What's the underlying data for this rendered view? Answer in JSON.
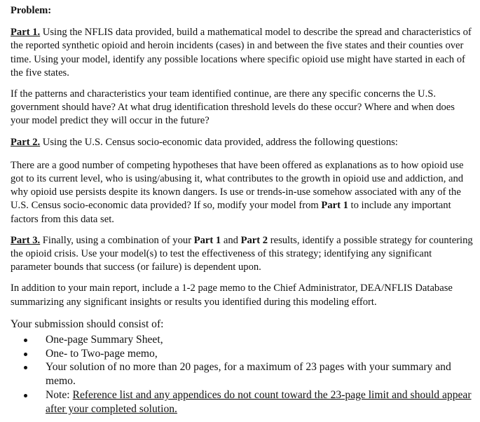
{
  "heading": "Problem:",
  "part1": {
    "label": "Part 1.",
    "text": " Using the NFLIS data provided, build a mathematical model to describe the spread and characteristics of the reported synthetic opioid and heroin incidents (cases) in and between the five states and their counties over time. Using your model, identify any possible locations where specific opioid use might have started in each of the five states."
  },
  "concerns": "If the patterns and characteristics your team identified continue, are there any specific concerns the U.S. government should have? At what drug identification threshold levels do these occur? Where and when does your model predict they will occur in the future?",
  "part2": {
    "label": "Part 2.",
    "text": " Using the U.S. Census socio-economic data provided, address the following questions:"
  },
  "hypotheses": {
    "text": "There are a good number of competing hypotheses that have been offered as explanations as to how opioid use got to its current level, who is using/abusing it, what contributes to the growth in opioid use and addiction, and why opioid use persists despite its known dangers. Is use or trends-in-use somehow associated with any of the U.S. Census socio-economic data provided? If so, modify your model from ",
    "bold": "Part 1",
    "end": " to include any important factors from this data set."
  },
  "part3": {
    "label": "Part 3.",
    "t1": " Finally, using a combination of your ",
    "b1": "Part 1",
    "t2": " and ",
    "b2": "Part 2",
    "t3": " results, identify a possible strategy for countering the opioid crisis. Use your model(s) to test the effectiveness of this strategy; identifying any significant parameter bounds that success (or failure) is dependent upon."
  },
  "memo": "In addition to your main report, include a 1-2 page memo to the Chief Administrator, DEA/NFLIS Database summarizing any significant insights or results you identified during this modeling effort.",
  "submission": {
    "intro": "Your submission should consist of:",
    "items": [
      "One-page Summary Sheet,",
      "One- to Two-page memo,",
      "Your solution of no more than 20 pages, for a maximum of 23 pages with your summary and memo."
    ],
    "note_label": "Note: ",
    "note_text": "Reference list and any appendices do not count toward the 23-page limit and should appear after your completed solution."
  }
}
